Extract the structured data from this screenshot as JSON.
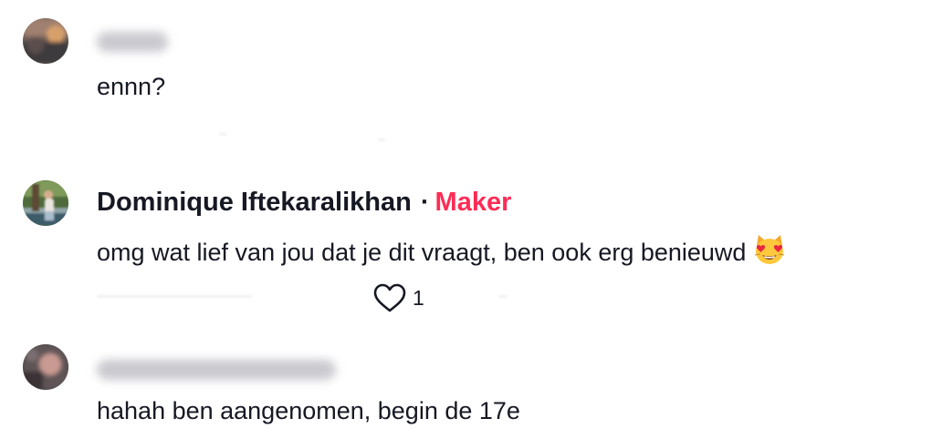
{
  "comments": [
    {
      "author_blurred": true,
      "text": "ennn?"
    },
    {
      "author": "Dominique Iftekaralikhan",
      "separator": "·",
      "badge": "Maker",
      "text": "omg wat lief van jou dat je dit vraagt, ben ook erg benieuwd",
      "emoji": "heart-eyes-cat-icon",
      "likes": "1"
    },
    {
      "author_blurred": true,
      "text": "hahah ben aangenomen, begin de 17e"
    }
  ],
  "colors": {
    "text": "#161823",
    "maker_badge": "#fe2c55",
    "blur": "#c9c9cf"
  }
}
